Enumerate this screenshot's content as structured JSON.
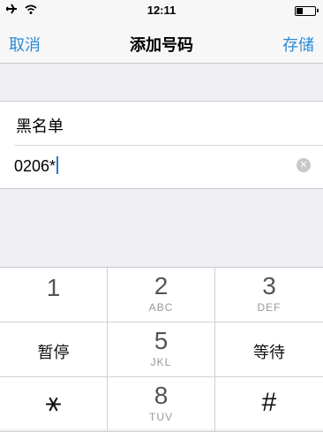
{
  "status": {
    "time": "12:11",
    "battery_level": 0.35
  },
  "nav": {
    "cancel": "取消",
    "title": "添加号码",
    "save": "存储"
  },
  "form": {
    "name": "黑名单",
    "number": "0206*"
  },
  "keypad": {
    "keys": [
      {
        "main": "1",
        "sub": ""
      },
      {
        "main": "2",
        "sub": "ABC"
      },
      {
        "main": "3",
        "sub": "DEF"
      },
      {
        "main": "暂停",
        "sub": ""
      },
      {
        "main": "5",
        "sub": "JKL"
      },
      {
        "main": "等待",
        "sub": ""
      },
      {
        "main": "⚹",
        "sub": ""
      },
      {
        "main": "8",
        "sub": "TUV"
      },
      {
        "main": "#",
        "sub": ""
      }
    ]
  },
  "colors": {
    "accent": "#2b8bd4",
    "background": "#efeff4"
  }
}
